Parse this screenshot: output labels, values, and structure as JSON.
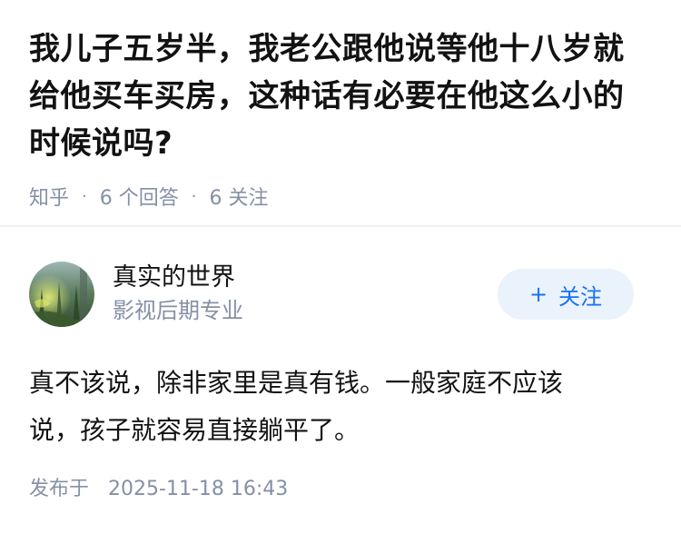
{
  "question": {
    "title": "我儿子五岁半，我老公跟他说等他十八岁就给他买车买房，这种话有必要在他这么小的时候说吗?",
    "source": "知乎",
    "answer_count": "6 个回答",
    "follower_count": "6 关注"
  },
  "answer": {
    "author_name": "真实的世界",
    "author_headline": "影视后期专业",
    "follow_label": "关注",
    "content": "真不该说，除非家里是真有钱。一般家庭不应该说，孩子就容易直接躺平了。",
    "publish_prefix": "发布于",
    "publish_time": "2025-11-18 16:43"
  },
  "colors": {
    "accent": "#1772f6",
    "follow_bg": "#eaf2fb",
    "meta_gray": "#8590a6",
    "text": "#121212"
  }
}
